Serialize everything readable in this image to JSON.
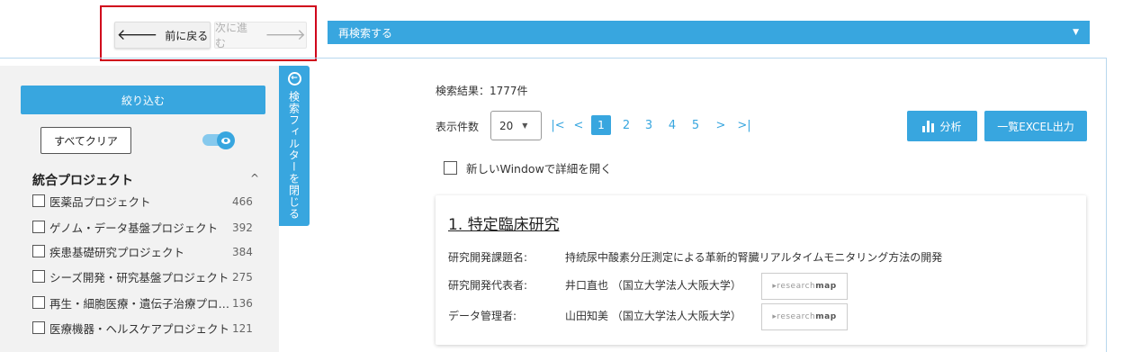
{
  "nav": {
    "back_label": "前に戻る",
    "forward_label": "次に進む",
    "back_arrow": "🡐",
    "forward_arrow": "🡒"
  },
  "research": {
    "label": "再検索する",
    "caret": "▼"
  },
  "sidebar": {
    "narrow_label": "絞り込む",
    "clear_label": "すべてクリア",
    "project_title": "統合プロジェクト",
    "collapse_caret": "^",
    "items": [
      {
        "label": "医薬品プロジェクト",
        "count": "466"
      },
      {
        "label": "ゲノム・データ基盤プロジェクト",
        "count": "392"
      },
      {
        "label": "疾患基礎研究プロジェクト",
        "count": "384"
      },
      {
        "label": "シーズ開発・研究基盤プロジェクト",
        "count": "275"
      },
      {
        "label": "再生・細胞医療・遺伝子治療プロジェクト",
        "count": "136"
      },
      {
        "label": "医療機器・ヘルスケアプロジェクト",
        "count": "121"
      }
    ]
  },
  "filter_tab": {
    "label": "検索フィルターを閉じる",
    "icon": "←"
  },
  "results": {
    "count_text": "検索結果：1777件",
    "per_page_label": "表示件数",
    "per_page_value": "20",
    "pages": [
      "1",
      "2",
      "3",
      "4",
      "5"
    ],
    "first_icon": "|<",
    "prev_icon": "<",
    "next_icon": ">",
    "last_icon": ">|",
    "analyze_label": "分析",
    "excel_label": "一覧EXCEL出力",
    "new_window_label": "新しいWindowで詳細を開く"
  },
  "card": {
    "title": "1. 特定臨床研究",
    "rows": [
      {
        "label": "研究開発課題名:",
        "value": "持続尿中酸素分圧測定による革新的腎臓リアルタイムモニタリング方法の開発"
      },
      {
        "label": "研究開発代表者:",
        "value": "井口直也 （国立大学法人大阪大学）",
        "badge_pre": "▸research",
        "badge_bold": "map"
      },
      {
        "label": "データ管理者:",
        "value": "山田知美 （国立大学法人大阪大学）",
        "badge_pre": "▸research",
        "badge_bold": "map"
      }
    ]
  },
  "colors": {
    "accent": "#38a6df",
    "highlight": "#d0021b",
    "sidebar_bg": "#f2f2f2"
  }
}
